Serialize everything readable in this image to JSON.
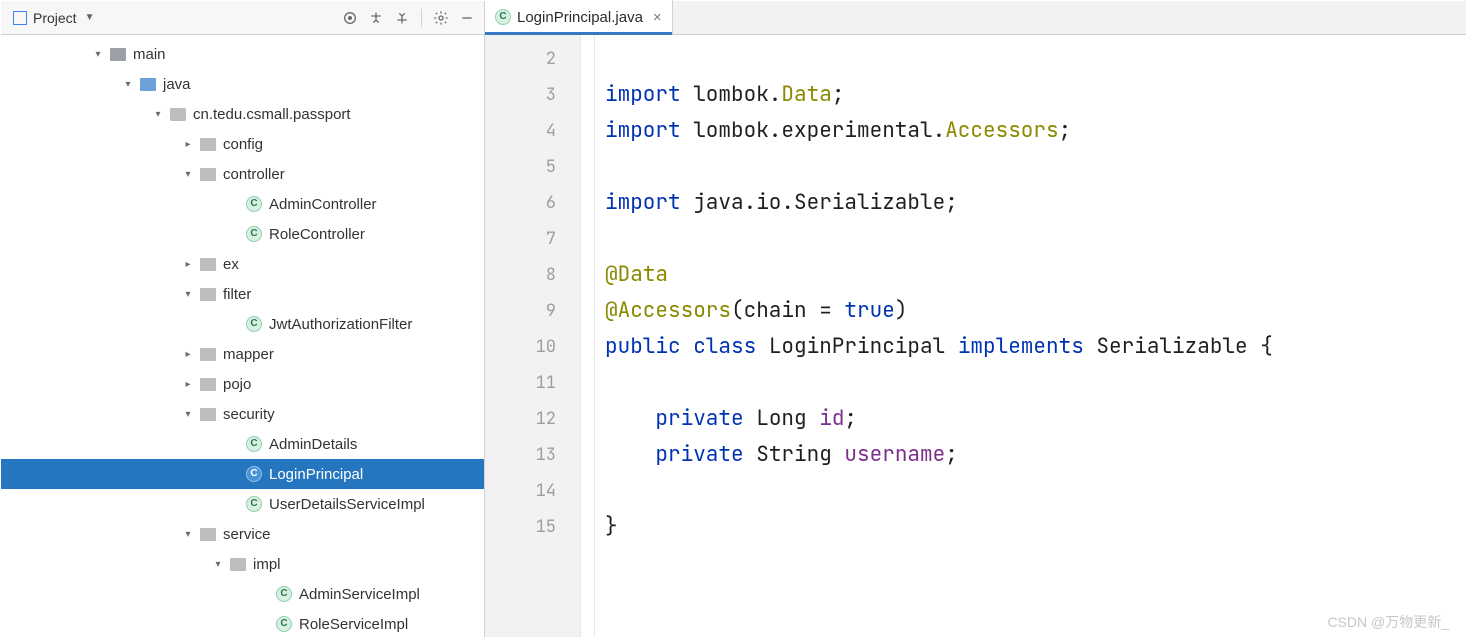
{
  "sidebar": {
    "title": "Project",
    "tree": [
      {
        "indent": 90,
        "chev": "down",
        "icon": "folder-gray",
        "label": "main"
      },
      {
        "indent": 120,
        "chev": "down",
        "icon": "folder-blue",
        "label": "java"
      },
      {
        "indent": 150,
        "chev": "down",
        "icon": "folder-pkg",
        "label": "cn.tedu.csmall.passport"
      },
      {
        "indent": 180,
        "chev": "right",
        "icon": "folder-pkg",
        "label": "config"
      },
      {
        "indent": 180,
        "chev": "down",
        "icon": "folder-pkg",
        "label": "controller"
      },
      {
        "indent": 226,
        "chev": "",
        "icon": "class",
        "label": "AdminController"
      },
      {
        "indent": 226,
        "chev": "",
        "icon": "class",
        "label": "RoleController"
      },
      {
        "indent": 180,
        "chev": "right",
        "icon": "folder-pkg",
        "label": "ex"
      },
      {
        "indent": 180,
        "chev": "down",
        "icon": "folder-pkg",
        "label": "filter"
      },
      {
        "indent": 226,
        "chev": "",
        "icon": "class",
        "label": "JwtAuthorizationFilter"
      },
      {
        "indent": 180,
        "chev": "right",
        "icon": "folder-pkg",
        "label": "mapper"
      },
      {
        "indent": 180,
        "chev": "right",
        "icon": "folder-pkg",
        "label": "pojo"
      },
      {
        "indent": 180,
        "chev": "down",
        "icon": "folder-pkg",
        "label": "security"
      },
      {
        "indent": 226,
        "chev": "",
        "icon": "class",
        "label": "AdminDetails"
      },
      {
        "indent": 226,
        "chev": "",
        "icon": "class",
        "label": "LoginPrincipal",
        "selected": true
      },
      {
        "indent": 226,
        "chev": "",
        "icon": "class",
        "label": "UserDetailsServiceImpl"
      },
      {
        "indent": 180,
        "chev": "down",
        "icon": "folder-pkg",
        "label": "service"
      },
      {
        "indent": 210,
        "chev": "down",
        "icon": "folder-pkg",
        "label": "impl"
      },
      {
        "indent": 256,
        "chev": "",
        "icon": "class",
        "label": "AdminServiceImpl"
      },
      {
        "indent": 256,
        "chev": "",
        "icon": "class",
        "label": "RoleServiceImpl"
      }
    ]
  },
  "editor": {
    "tab": {
      "label": "LoginPrincipal.java"
    },
    "gutter_start": 2,
    "gutter_end": 15,
    "lines": [
      {
        "n": 2,
        "seg": []
      },
      {
        "n": 3,
        "seg": [
          {
            "t": "import ",
            "c": "kw"
          },
          {
            "t": "lombok.",
            "c": "txt"
          },
          {
            "t": "Data",
            "c": "ann"
          },
          {
            "t": ";",
            "c": "txt"
          }
        ]
      },
      {
        "n": 4,
        "seg": [
          {
            "t": "import ",
            "c": "kw"
          },
          {
            "t": "lombok.experimental.",
            "c": "txt"
          },
          {
            "t": "Accessors",
            "c": "ann"
          },
          {
            "t": ";",
            "c": "txt"
          }
        ]
      },
      {
        "n": 5,
        "seg": []
      },
      {
        "n": 6,
        "seg": [
          {
            "t": "import ",
            "c": "kw"
          },
          {
            "t": "java.io.Serializable;",
            "c": "txt"
          }
        ]
      },
      {
        "n": 7,
        "seg": []
      },
      {
        "n": 8,
        "seg": [
          {
            "t": "@Data",
            "c": "ann"
          }
        ]
      },
      {
        "n": 9,
        "seg": [
          {
            "t": "@Accessors",
            "c": "ann"
          },
          {
            "t": "(chain = ",
            "c": "txt"
          },
          {
            "t": "true",
            "c": "bool"
          },
          {
            "t": ")",
            "c": "txt"
          }
        ]
      },
      {
        "n": 10,
        "seg": [
          {
            "t": "public class ",
            "c": "kw"
          },
          {
            "t": "LoginPrincipal ",
            "c": "txt"
          },
          {
            "t": "implements ",
            "c": "kw"
          },
          {
            "t": "Serializable {",
            "c": "txt"
          }
        ]
      },
      {
        "n": 11,
        "seg": []
      },
      {
        "n": 12,
        "seg": [
          {
            "t": "    ",
            "c": "txt"
          },
          {
            "t": "private ",
            "c": "kw"
          },
          {
            "t": "Long ",
            "c": "txt"
          },
          {
            "t": "id",
            "c": "fld"
          },
          {
            "t": ";",
            "c": "txt"
          }
        ]
      },
      {
        "n": 13,
        "seg": [
          {
            "t": "    ",
            "c": "txt"
          },
          {
            "t": "private ",
            "c": "kw"
          },
          {
            "t": "String ",
            "c": "txt"
          },
          {
            "t": "username",
            "c": "fld"
          },
          {
            "t": ";",
            "c": "txt"
          }
        ]
      },
      {
        "n": 14,
        "seg": []
      },
      {
        "n": 15,
        "seg": [
          {
            "t": "}",
            "c": "txt"
          }
        ]
      }
    ]
  },
  "watermark": "CSDN @万物更新_"
}
